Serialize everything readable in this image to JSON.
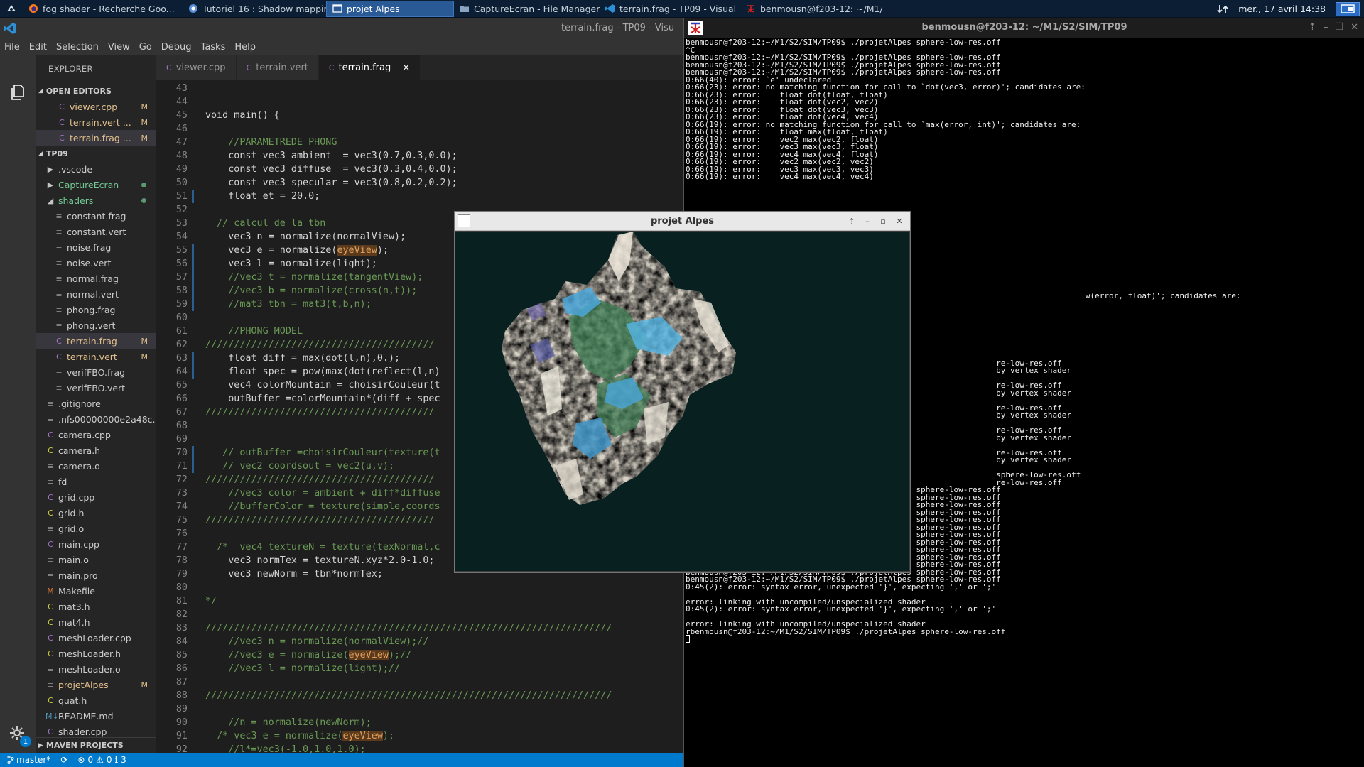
{
  "taskbar": {
    "tasks": [
      {
        "label": "fog shader - Recherche Goo...",
        "icon": "firefox-icon"
      },
      {
        "label": "Tutoriel 16 : Shadow mappin...",
        "icon": "chromium-icon"
      },
      {
        "label": "projet Alpes",
        "icon": "window-icon"
      },
      {
        "label": "CaptureEcran - File Manager",
        "icon": "folder-icon"
      },
      {
        "label": "terrain.frag - TP09 - Visual St...",
        "icon": "vscode-icon"
      },
      {
        "label": "benmousn@f203-12: ~/M1/S...",
        "icon": "terminal-icon"
      }
    ],
    "clock": "mer., 17 avril 14:38"
  },
  "vscode": {
    "title": "terrain.frag - TP09 - Visu",
    "menu": [
      "File",
      "Edit",
      "Selection",
      "View",
      "Go",
      "Debug",
      "Tasks",
      "Help"
    ],
    "explorer_label": "EXPLORER",
    "open_editors_label": "OPEN EDITORS",
    "open_editors": [
      {
        "name": "viewer.cpp",
        "badge": "M"
      },
      {
        "name": "terrain.vert ...",
        "badge": "M"
      },
      {
        "name": "terrain.frag ...",
        "badge": "M"
      }
    ],
    "project_label": "TP09",
    "tree": [
      {
        "name": ".vscode",
        "kind": "folder",
        "depth": 1
      },
      {
        "name": "CaptureEcran",
        "kind": "folder",
        "depth": 1,
        "status": "untracked"
      },
      {
        "name": "shaders",
        "kind": "folder-open",
        "depth": 1,
        "status": "modified-dot"
      },
      {
        "name": "constant.frag",
        "kind": "file",
        "depth": 2
      },
      {
        "name": "constant.vert",
        "kind": "file",
        "depth": 2
      },
      {
        "name": "noise.frag",
        "kind": "file",
        "depth": 2
      },
      {
        "name": "noise.vert",
        "kind": "file",
        "depth": 2
      },
      {
        "name": "normal.frag",
        "kind": "file",
        "depth": 2
      },
      {
        "name": "normal.vert",
        "kind": "file",
        "depth": 2
      },
      {
        "name": "phong.frag",
        "kind": "file",
        "depth": 2
      },
      {
        "name": "phong.vert",
        "kind": "file",
        "depth": 2
      },
      {
        "name": "terrain.frag",
        "kind": "cfile",
        "depth": 2,
        "badge": "M",
        "selected": true
      },
      {
        "name": "terrain.vert",
        "kind": "cfile",
        "depth": 2,
        "badge": "M"
      },
      {
        "name": "verifFBO.frag",
        "kind": "file",
        "depth": 2
      },
      {
        "name": "verifFBO.vert",
        "kind": "file",
        "depth": 2
      },
      {
        "name": ".gitignore",
        "kind": "file",
        "depth": 1
      },
      {
        "name": ".nfs00000000e2a48c...",
        "kind": "file",
        "depth": 1
      },
      {
        "name": "camera.cpp",
        "kind": "cfile",
        "depth": 1
      },
      {
        "name": "camera.h",
        "kind": "hfile",
        "depth": 1
      },
      {
        "name": "camera.o",
        "kind": "file",
        "depth": 1
      },
      {
        "name": "fd",
        "kind": "file",
        "depth": 1
      },
      {
        "name": "grid.cpp",
        "kind": "cfile",
        "depth": 1
      },
      {
        "name": "grid.h",
        "kind": "hfile",
        "depth": 1
      },
      {
        "name": "grid.o",
        "kind": "file",
        "depth": 1
      },
      {
        "name": "main.cpp",
        "kind": "cfile",
        "depth": 1
      },
      {
        "name": "main.o",
        "kind": "file",
        "depth": 1
      },
      {
        "name": "main.pro",
        "kind": "file",
        "depth": 1
      },
      {
        "name": "Makefile",
        "kind": "mfile",
        "depth": 1
      },
      {
        "name": "mat3.h",
        "kind": "hfile",
        "depth": 1
      },
      {
        "name": "mat4.h",
        "kind": "hfile",
        "depth": 1
      },
      {
        "name": "meshLoader.cpp",
        "kind": "cfile",
        "depth": 1
      },
      {
        "name": "meshLoader.h",
        "kind": "hfile",
        "depth": 1
      },
      {
        "name": "meshLoader.o",
        "kind": "file",
        "depth": 1
      },
      {
        "name": "projetAlpes",
        "kind": "file",
        "depth": 1,
        "badge": "M"
      },
      {
        "name": "quat.h",
        "kind": "hfile",
        "depth": 1
      },
      {
        "name": "README.md",
        "kind": "mdfile",
        "depth": 1
      },
      {
        "name": "shader.cpp",
        "kind": "cfile",
        "depth": 1
      }
    ],
    "maven_label": "MAVEN PROJECTS",
    "tabs": [
      {
        "label": "viewer.cpp",
        "active": false
      },
      {
        "label": "terrain.vert",
        "active": false
      },
      {
        "label": "terrain.frag",
        "active": true
      }
    ],
    "gear_badge": "1",
    "status": {
      "branch": "master*",
      "errors": "0",
      "warnings": "0",
      "info": "3"
    }
  },
  "code_lines": [
    {
      "n": "43",
      "t": ""
    },
    {
      "n": "44",
      "t": ""
    },
    {
      "n": "45",
      "t": "void main() {"
    },
    {
      "n": "46",
      "t": ""
    },
    {
      "n": "47",
      "t": "    //PARAMETREDE PHONG"
    },
    {
      "n": "48",
      "t": "    const vec3 ambient  = vec3(0.7,0.3,0.0);"
    },
    {
      "n": "49",
      "t": "    const vec3 diffuse  = vec3(0.3,0.4,0.0);"
    },
    {
      "n": "50",
      "t": "    const vec3 specular = vec3(0.8,0.2,0.2);"
    },
    {
      "n": "51",
      "t": "    float et = 20.0;"
    },
    {
      "n": "52",
      "t": ""
    },
    {
      "n": "53",
      "t": "  // calcul de la tbn"
    },
    {
      "n": "54",
      "t": "    vec3 n = normalize(normalView);"
    },
    {
      "n": "55",
      "t": "    vec3 e = normalize(eyeView);"
    },
    {
      "n": "56",
      "t": "    vec3 l = normalize(light);"
    },
    {
      "n": "57",
      "t": "    //vec3 t = normalize(tangentView);"
    },
    {
      "n": "58",
      "t": "    //vec3 b = normalize(cross(n,t));"
    },
    {
      "n": "59",
      "t": "    //mat3 tbn = mat3(t,b,n);"
    },
    {
      "n": "60",
      "t": ""
    },
    {
      "n": "61",
      "t": "    //PHONG MODEL"
    },
    {
      "n": "62",
      "t": "////////////////////////////////////////"
    },
    {
      "n": "63",
      "t": "    float diff = max(dot(l,n),0.);"
    },
    {
      "n": "64",
      "t": "    float spec = pow(max(dot(reflect(l,n)"
    },
    {
      "n": "65",
      "t": "    vec4 colorMountain = choisirCouleur(t"
    },
    {
      "n": "66",
      "t": "    outBuffer =colorMountain*(diff + spec"
    },
    {
      "n": "67",
      "t": "////////////////////////////////////////"
    },
    {
      "n": "68",
      "t": ""
    },
    {
      "n": "69",
      "t": ""
    },
    {
      "n": "70",
      "t": "   // outBuffer =choisirCouleur(texture(t"
    },
    {
      "n": "71",
      "t": "   // vec2 coordsout = vec2(u,v);"
    },
    {
      "n": "72",
      "t": "////////////////////////////////////////"
    },
    {
      "n": "73",
      "t": "    //vec3 color = ambient + diff*diffuse"
    },
    {
      "n": "74",
      "t": "    //bufferColor = texture(simple,coords"
    },
    {
      "n": "75",
      "t": "////////////////////////////////////////"
    },
    {
      "n": "76",
      "t": ""
    },
    {
      "n": "77",
      "t": "  /*  vec4 textureN = texture(texNormal,c"
    },
    {
      "n": "78",
      "t": "    vec3 normTex = textureN.xyz*2.0-1.0;"
    },
    {
      "n": "79",
      "t": "    vec3 newNorm = tbn*normTex;"
    },
    {
      "n": "80",
      "t": ""
    },
    {
      "n": "81",
      "t": "*/"
    },
    {
      "n": "82",
      "t": ""
    },
    {
      "n": "83",
      "t": "///////////////////////////////////////////////////////////////////////"
    },
    {
      "n": "84",
      "t": "    //vec3 n = normalize(normalView);//"
    },
    {
      "n": "85",
      "t": "    //vec3 e = normalize(eyeView);//"
    },
    {
      "n": "86",
      "t": "    //vec3 l = normalize(light);//"
    },
    {
      "n": "87",
      "t": ""
    },
    {
      "n": "88",
      "t": "///////////////////////////////////////////////////////////////////////"
    },
    {
      "n": "89",
      "t": ""
    },
    {
      "n": "90",
      "t": "    //n = normalize(newNorm);"
    },
    {
      "n": "91",
      "t": "  /* vec3 e = normalize(eyeView);"
    },
    {
      "n": "92",
      "t": "    //l*=vec3(-1.0,1.0,1.0);"
    }
  ],
  "terminal": {
    "title": "benmousn@f203-12: ~/M1/S2/SIM/TP09",
    "lines": [
      "benmousn@f203-12:~/M1/S2/SIM/TP09$ ./projetAlpes sphere-low-res.off",
      "^C",
      "benmousn@f203-12:~/M1/S2/SIM/TP09$ ./projetAlpes sphere-low-res.off",
      "benmousn@f203-12:~/M1/S2/SIM/TP09$ ./projetAlpes sphere-low-res.off",
      "benmousn@f203-12:~/M1/S2/SIM/TP09$ ./projetAlpes sphere-low-res.off",
      "0:66(40): error: `e' undeclared",
      "0:66(23): error: no matching function for call to `dot(vec3, error)'; candidates are:",
      "0:66(23): error:    float dot(float, float)",
      "0:66(23): error:    float dot(vec2, vec2)",
      "0:66(23): error:    float dot(vec3, vec3)",
      "0:66(23): error:    float dot(vec4, vec4)",
      "0:66(19): error: no matching function for call to `max(error, int)'; candidates are:",
      "0:66(19): error:    float max(float, float)",
      "0:66(19): error:    vec2 max(vec2, float)",
      "0:66(19): error:    vec3 max(vec3, float)",
      "0:66(19): error:    vec4 max(vec4, float)",
      "0:66(19): error:    vec2 max(vec2, vec2)",
      "0:66(19): error:    vec3 max(vec3, vec3)",
      "0:66(19): error:    vec4 max(vec4, vec4)",
      "",
      "",
      "",
      "",
      "",
      "",
      "",
      "",
      "",
      "",
      "",
      "",
      "",
      "",
      "",
      "                                                                                     w(error, float)'; candidates are:",
      "",
      "",
      "",
      "",
      "",
      "",
      "",
      "",
      "                                                                  re-low-res.off",
      "                                                                  by vertex shader",
      "",
      "                                                                  re-low-res.off",
      "                                                                  by vertex shader",
      "",
      "                                                                  re-low-res.off",
      "                                                                  by vertex shader",
      "",
      "                                                                  re-low-res.off",
      "                                                                  by vertex shader",
      "",
      "                                                                  re-low-res.off",
      "                                                                  by vertex shader",
      "",
      "                                                                  sphere-low-res.off",
      "                                                                  re-low-res.off",
      "benmousn@f203-12:~/M1/S2/SIM/TP09$ ./projetAlpes sphere-low-res.off",
      "benmousn@f203-12:~/M1/S2/SIM/TP09$ ./projetAlpes sphere-low-res.off",
      "benmousn@f203-12:~/M1/S2/SIM/TP09$ ./projetAlpes sphere-low-res.off",
      "benmousn@f203-12:~/M1/S2/SIM/TP09$ ./projetAlpes sphere-low-res.off",
      "benmousn@f203-12:~/M1/S2/SIM/TP09$ ./projetAlpes sphere-low-res.off",
      "benmousn@f203-12:~/M1/S2/SIM/TP09$ ./projetAlpes sphere-low-res.off",
      "benmousn@f203-12:~/M1/S2/SIM/TP09$ ./projetAlpes sphere-low-res.off",
      "benmousn@f203-12:~/M1/S2/SIM/TP09$ ./projetAlpes sphere-low-res.off",
      "benmousn@f203-12:~/M1/S2/SIM/TP09$ ./projetAlpes sphere-low-res.off",
      "benmousn@f203-12:~/M1/S2/SIM/TP09$ ./projetAlpes sphere-low-res.off",
      "benmousn@f203-12:~/M1/S2/SIM/TP09$ ./projetAlpes sphere-low-res.off",
      "benmousn@f203-12:~/M1/S2/SIM/TP09$ ./projetAlpes sphere-low-res.off",
      "benmousn@f203-12:~/M1/S2/SIM/TP09$ ./projetAlpes sphere-low-res.off",
      "0:45(2): error: syntax error, unexpected '}', expecting ',' or ';'",
      "",
      "error: linking with uncompiled/unspecialized shader",
      "0:45(2): error: syntax error, unexpected '}', expecting ',' or ';'",
      "",
      "error: linking with uncompiled/unspecialized shader",
      "rbenmousn@f203-12:~/M1/S2/SIM/TP09$ ./projetAlpes sphere-low-res.off"
    ]
  },
  "alpes_window": {
    "title": "projet Alpes",
    "background": "#082020"
  },
  "colors": {
    "vscode_accent": "#007acc",
    "taskbar": "#0b1e33",
    "active_task": "#2a5a95"
  }
}
